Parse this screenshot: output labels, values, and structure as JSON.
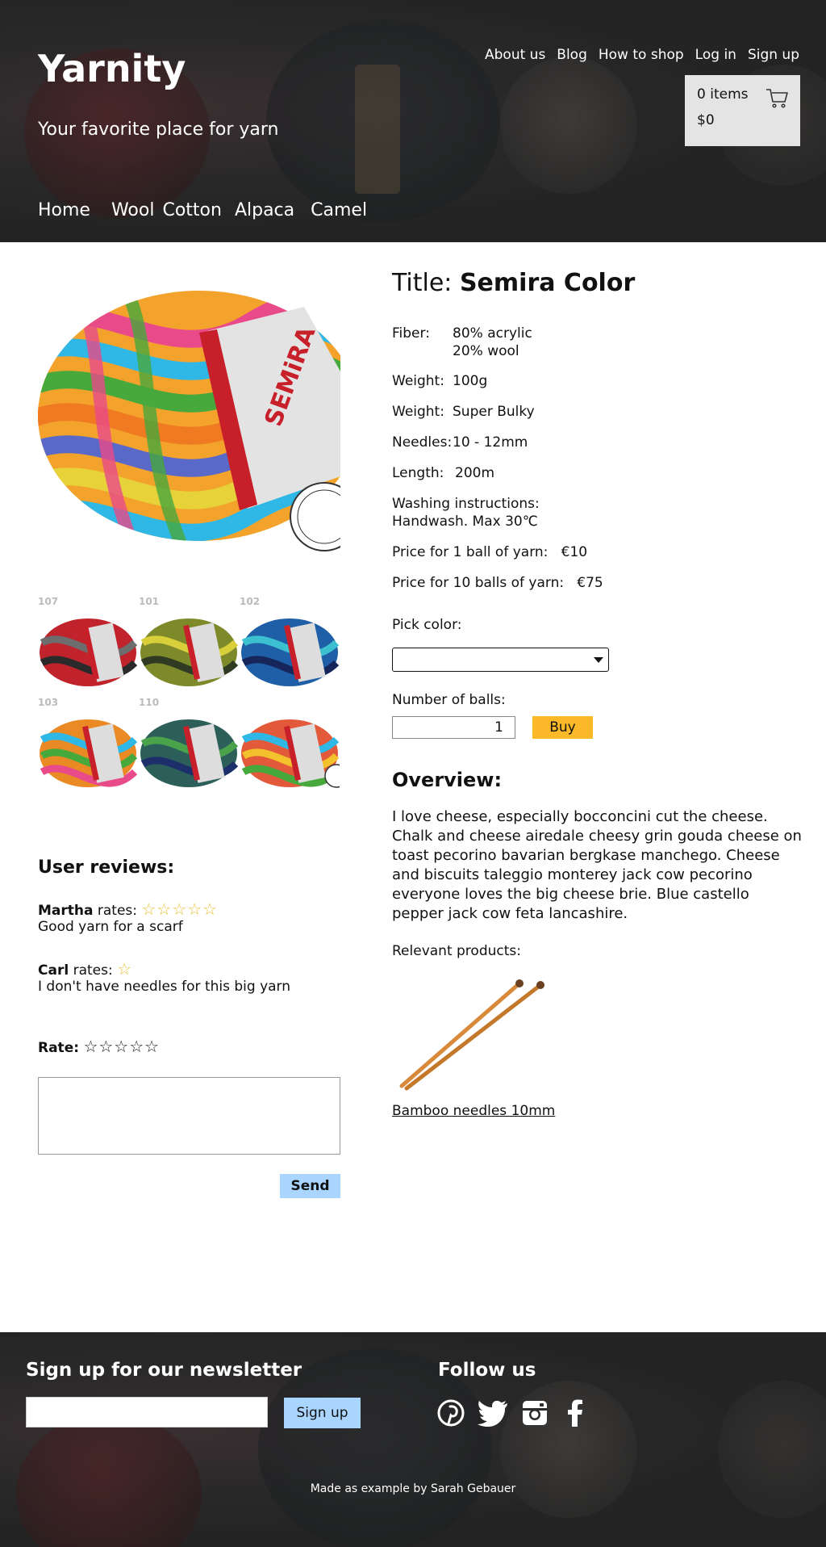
{
  "header": {
    "site_title": "Yarnity",
    "tagline": "Your favorite place for yarn",
    "top_nav": [
      "About us",
      "Blog",
      "How to shop",
      "Log in",
      "Sign up"
    ],
    "cart": {
      "count": "0 items",
      "total": "$0"
    },
    "categories": [
      "Home",
      "Wool",
      "Cotton",
      "Alpaca",
      "Camel"
    ]
  },
  "gallery": {
    "thumbnails": [
      {
        "number": "107",
        "color": "#c0232c"
      },
      {
        "number": "101",
        "color": "#7e8a2a"
      },
      {
        "number": "102",
        "color": "#1f5fa8"
      },
      {
        "number": "103",
        "color": "#e98a24"
      },
      {
        "number": "110",
        "color": "#2c5f5a"
      },
      {
        "number": "",
        "color": "#e25a3a"
      }
    ]
  },
  "reviews": {
    "heading": "User reviews:",
    "items": [
      {
        "name": "Martha",
        "rates_label": "rates:",
        "stars": "☆☆☆☆☆",
        "comment": "Good yarn for a scarf"
      },
      {
        "name": "Carl",
        "rates_label": "rates:",
        "stars": "☆",
        "comment": "I don't have needles for this big yarn"
      }
    ],
    "rate_label": "Rate:",
    "rate_stars": "☆☆☆☆☆",
    "send_label": "Send"
  },
  "product": {
    "title_prefix": "Title:",
    "title": "Semira Color",
    "fiber_label": "Fiber:",
    "fiber_line1": "80% acrylic",
    "fiber_line2": "20% wool",
    "weight_label": "Weight:",
    "weight_value": "100g",
    "weight2_label": "Weight:",
    "weight2_value": "Super Bulky",
    "needles_label": "Needles:",
    "needles_value": "10 - 12mm",
    "length_label": "Length:",
    "length_value": "200m",
    "washing_label": "Washing instructions:",
    "washing_value": "Handwash. Max 30℃",
    "price1_label": "Price for 1 ball of yarn:",
    "price1_value": "€10",
    "price10_label": "Price for 10 balls of yarn:",
    "price10_value": "€75",
    "pick_color_label": "Pick color:",
    "balls_label": "Number of balls:",
    "quantity": "1",
    "buy_label": "Buy"
  },
  "overview": {
    "heading": "Overview:",
    "text": "I love cheese, especially bocconcini cut the cheese. Chalk and cheese airedale cheesy grin gouda cheese on toast pecorino bavarian bergkase manchego. Cheese and biscuits taleggio monterey jack cow pecorino everyone loves the big cheese brie. Blue castello pepper jack cow feta lancashire."
  },
  "relevant": {
    "label": "Relevant products:",
    "product_name": "Bamboo needles 10mm"
  },
  "footer": {
    "newsletter_heading": "Sign up for our newsletter",
    "signup_label": "Sign up",
    "follow_heading": "Follow us",
    "social_icons": [
      "pinterest-icon",
      "twitter-icon",
      "instagram-icon",
      "facebook-icon"
    ],
    "credit": "Made as example by Sarah Gebauer"
  },
  "colors": {
    "buy_button": "#fbb828",
    "send_button": "#a9d5ff",
    "header_bg": "#2b2b2b"
  }
}
